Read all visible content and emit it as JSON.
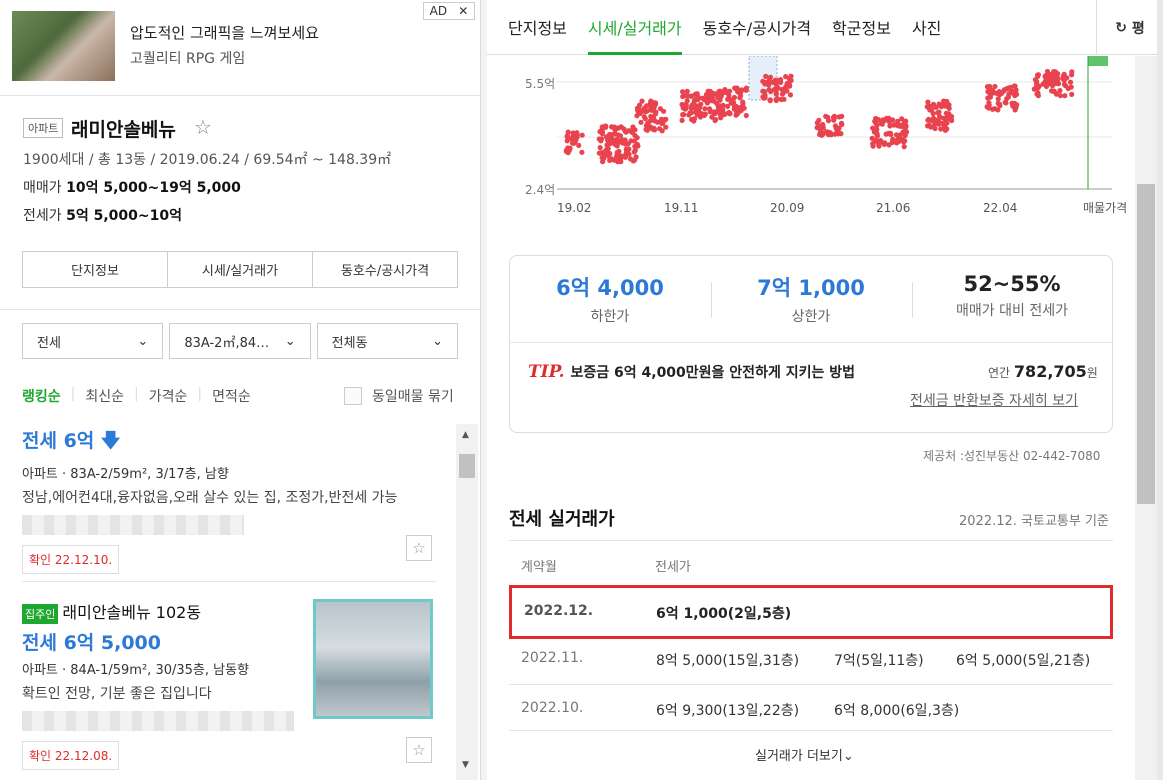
{
  "ad": {
    "badge": "AD",
    "close": "✕",
    "title": "압도적인 그래픽을 느껴보세요",
    "subtitle": "고퀄리티 RPG 게임"
  },
  "complex": {
    "tag": "아파트",
    "name": "래미안솔베뉴",
    "meta": "1900세대 / 총 13동 / 2019.06.24 / 69.54㎡ ~ 148.39㎡",
    "sale_label": "매매가",
    "sale_value": "10억 5,000~19억 5,000",
    "jeonse_label": "전세가",
    "jeonse_value": "5억 5,000~10억",
    "tabs": [
      "단지정보",
      "시세/실거래가",
      "동호수/공시가격"
    ]
  },
  "filters": {
    "type": "전세",
    "area": "83A-2㎡,84…",
    "dong": "전체동"
  },
  "sort": {
    "options": [
      "랭킹순",
      "최신순",
      "가격순",
      "면적순"
    ],
    "dup": "동일매물 묶기"
  },
  "listings": [
    {
      "price": "전세 6억",
      "desc1": "아파트 · 83A-2/59m², 3/17층, 남향",
      "desc2": "정남,에어컨4대,융자없음,오래 살수 있는 집, 조정가,반전세 가능",
      "confirm": "확인 22.12.10."
    },
    {
      "owner": "집주인",
      "title": "래미안솔베뉴 102동",
      "price": "전세 6억 5,000",
      "desc1": "아파트 · 84A-1/59m², 30/35층, 남동향",
      "desc2": "확트인 전망, 기분 좋은 집입니다",
      "confirm": "확인 22.12.08."
    }
  ],
  "right_tabs": [
    "단지정보",
    "시세/실거래가",
    "동호수/공시가격",
    "학군정보",
    "사진"
  ],
  "refresh_label": "평",
  "chart_data": {
    "type": "scatter",
    "y_ticks": [
      "5.5억",
      "2.4억"
    ],
    "x_ticks": [
      "19.02",
      "19.11",
      "20.09",
      "21.06",
      "22.04",
      "매물가격"
    ],
    "points_color": "#e8434f",
    "accent": "#1fa830"
  },
  "summary": {
    "low_value": "6억 4,000",
    "low_label": "하한가",
    "high_value": "7억 1,000",
    "high_label": "상한가",
    "ratio_value": "52~55%",
    "ratio_label": "매매가 대비 전세가",
    "tip_mark": "TIP.",
    "tip_text": "보증금 6억 4,000만원을 안전하게 지키는 방법",
    "annual_label": "연간",
    "annual_value": "782,705",
    "annual_unit": "원",
    "guide_link": "전세금 반환보증 자세히 보기"
  },
  "source": "제공처 :성진부동산 02-442-7080",
  "deals": {
    "title": "전세 실거래가",
    "basis": "2022.12. 국토교통부 기준",
    "col_month": "계약월",
    "col_price": "전세가",
    "rows": [
      {
        "month": "2022.12.",
        "d1": "6억 1,000(2일,5층)",
        "d2": "",
        "d3": ""
      },
      {
        "month": "2022.11.",
        "d1": "8억 5,000(15일,31층)",
        "d2": "7억(5일,11층)",
        "d3": "6억 5,000(5일,21층)"
      },
      {
        "month": "2022.10.",
        "d1": "6억 9,300(13일,22층)",
        "d2": "6억 8,000(6일,3층)",
        "d3": ""
      }
    ],
    "more": "실거래가 더보기"
  }
}
